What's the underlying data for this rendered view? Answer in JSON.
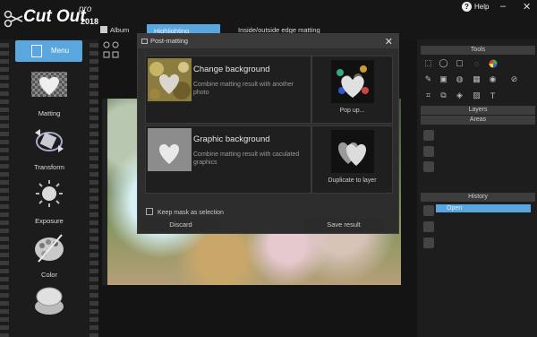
{
  "app": {
    "logo": "Cut Out",
    "pro": "pro",
    "year": "2018"
  },
  "header": {
    "tabs": [
      {
        "label": "Album"
      },
      {
        "label": "Highlighting"
      },
      {
        "label": "Inside/outside edge matting"
      }
    ],
    "help_label": "Help"
  },
  "sidebar": {
    "menu_label": "Menu",
    "items": [
      {
        "label": "Matting"
      },
      {
        "label": "Transform"
      },
      {
        "label": "Exposure"
      },
      {
        "label": "Color"
      }
    ]
  },
  "right_panel": {
    "tools_title": "Tools",
    "layers_title": "Layers",
    "areas_title": "Areas",
    "history_title": "History",
    "history_items": [
      "Open"
    ]
  },
  "dialog": {
    "title": "Post-matting",
    "change_bg": {
      "title": "Change background",
      "desc": "Combine matting result with another photo"
    },
    "popup_label": "Pop up...",
    "graphic_bg": {
      "title": "Graphic background",
      "desc": "Combine matting result with caculated graphics"
    },
    "duplicate_label": "Duplicate to layer",
    "keep_mask_label": "Keep mask as selection",
    "discard_label": "Discard",
    "save_label": "Save result"
  },
  "colors": {
    "accent": "#5aa7e0",
    "background": "#1b1b1b",
    "panel": "#2d2d2d"
  }
}
